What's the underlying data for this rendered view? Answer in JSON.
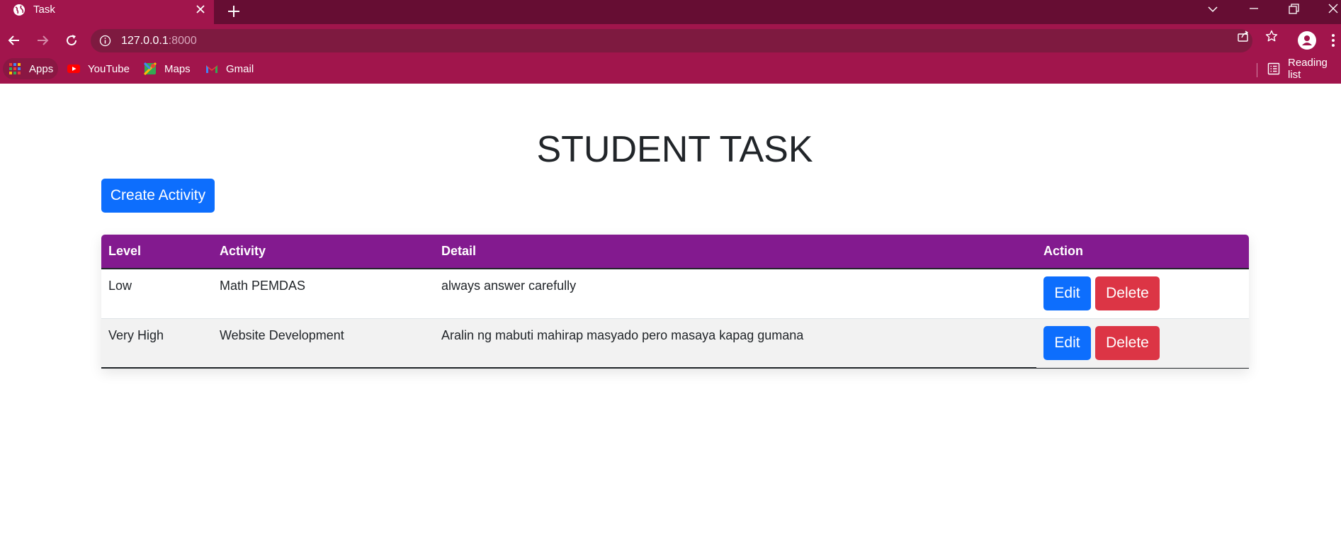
{
  "browser": {
    "tab_title": "Task",
    "url_host": "127.0.0.1",
    "url_port": ":8000",
    "bookmarks": [
      {
        "label": "Apps",
        "icon": "apps-grid-icon"
      },
      {
        "label": "YouTube",
        "icon": "youtube-icon"
      },
      {
        "label": "Maps",
        "icon": "maps-icon"
      },
      {
        "label": "Gmail",
        "icon": "gmail-icon"
      }
    ],
    "reading_list": "Reading list"
  },
  "page": {
    "title": "STUDENT TASK",
    "create_button": "Create Activity",
    "table": {
      "headers": [
        "Level",
        "Activity",
        "Detail",
        "Action"
      ],
      "rows": [
        {
          "level": "Low",
          "activity": "Math PEMDAS",
          "detail": "always answer carefully",
          "edit": "Edit",
          "delete": "Delete"
        },
        {
          "level": "Very High",
          "activity": "Website Development",
          "detail": "Aralin ng mabuti mahirap masyado pero masaya kapag gumana",
          "edit": "Edit",
          "delete": "Delete"
        }
      ]
    }
  },
  "colors": {
    "chrome_dark": "#660d33",
    "chrome_main": "#a1154c",
    "table_header": "#831a8f",
    "primary": "#0d6efd",
    "danger": "#dc3545"
  }
}
